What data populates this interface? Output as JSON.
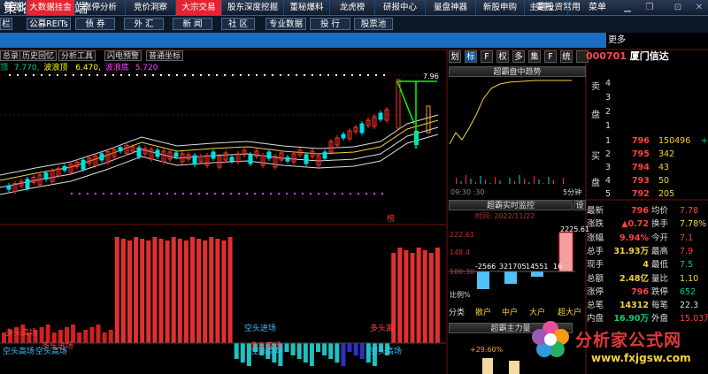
{
  "app": {
    "title": "策略投资终端"
  },
  "top_menu": [
    {
      "label": "栏"
    },
    {
      "label": "公募REITs"
    },
    {
      "label": "债 券"
    },
    {
      "label": "外 汇"
    },
    {
      "label": "新 闻"
    },
    {
      "label": "社 区"
    },
    {
      "label": "专业数据"
    },
    {
      "label": "投 行"
    },
    {
      "label": "股票池"
    }
  ],
  "right_menu": [
    {
      "label": "委托"
    },
    {
      "label": "常用"
    },
    {
      "label": "菜单"
    }
  ],
  "nav": {
    "items": [
      {
        "label": "捷金"
      },
      {
        "label": "大数据挂金"
      },
      {
        "label": "涨停分析"
      },
      {
        "label": "竞价洞察"
      },
      {
        "label": "大宗交易"
      },
      {
        "label": "股东深度挖掘"
      },
      {
        "label": "董秘爆料"
      },
      {
        "label": "龙虎榜"
      },
      {
        "label": "研报中心"
      },
      {
        "label": "量盘神器"
      },
      {
        "label": "新股申购"
      },
      {
        "label": "主题投资"
      }
    ],
    "more": "更多"
  },
  "chart_tools": [
    {
      "label": "总录"
    },
    {
      "label": "历史回忆"
    },
    {
      "label": "分析工具"
    },
    {
      "label": "闪电预警"
    },
    {
      "label": "普通坐标"
    }
  ],
  "indicator": {
    "prefix": "顶",
    "v1_label": "7.770,",
    "v2_name": "波浪顶",
    "v2_value": "6.470,",
    "v3_name": "波浪底",
    "v3_value": "5.720"
  },
  "chart_annotations": {
    "price_top": "7.96",
    "marker": "榜",
    "bottom_labels": [
      {
        "text": "多头高场"
      },
      {
        "text": "多头进场"
      },
      {
        "text": "空头高场"
      },
      {
        "text": "空头高场"
      },
      {
        "text": "多头离场"
      },
      {
        "text": "空头进场"
      },
      {
        "text": "多头离"
      },
      {
        "text": "空头高场"
      },
      {
        "text": "空头高场"
      }
    ]
  },
  "mid_tabs": [
    {
      "label": "划"
    },
    {
      "label": "标"
    },
    {
      "label": "F"
    },
    {
      "label": "权"
    },
    {
      "label": "多"
    },
    {
      "label": "集"
    },
    {
      "label": "F"
    },
    {
      "label": "统"
    }
  ],
  "mid_panel": {
    "intraday_title": "超霸盘中趋势",
    "intraday_footer_left": "09:30 :30",
    "intraday_footer_right": "5分钟",
    "monitor_title": "超霸实时监控",
    "monitor_time": "时间: 2022/11/22",
    "monitor_y1": "222.61",
    "monitor_y2": "148.4",
    "monitor_y3": "100.30",
    "monitor_pct": "比例%",
    "monitor_bars": [
      "-2566",
      "321705",
      "14551",
      "16"
    ],
    "monitor_top": "2225.61",
    "monitor_cats": [
      "分类",
      "散户",
      "中户",
      "大户",
      "超大户"
    ],
    "mainforce_title": "超霸主力量",
    "mainforce_value": "+29.60%"
  },
  "stock": {
    "code": "000701",
    "name": "厦门信达"
  },
  "orderbook": {
    "sell_label": "卖",
    "sell_label2": "盘",
    "buy_label": "买",
    "buy_label2": "盘",
    "buys": [
      {
        "level": "1",
        "price": "796",
        "vol": "150496",
        "flag": "+"
      },
      {
        "level": "2",
        "price": "795",
        "vol": "342"
      },
      {
        "level": "3",
        "price": "794",
        "vol": "43"
      },
      {
        "level": "4",
        "price": "793",
        "vol": "50"
      },
      {
        "level": "5",
        "price": "792",
        "vol": "205"
      }
    ],
    "sell_levels": [
      "4",
      "3",
      "2",
      "1"
    ]
  },
  "stats": [
    {
      "k1": "最新",
      "v1": "796",
      "k2": "均价",
      "v2": "7.78"
    },
    {
      "k1": "涨跌",
      "v1": "▲0.72",
      "k2": "换手",
      "v2": "7.78%"
    },
    {
      "k1": "涨幅",
      "v1": "9.94%",
      "k2": "今开",
      "v2": "7.1"
    },
    {
      "k1": "总手",
      "v1": "31.93万",
      "k2": "最高",
      "v2": "7.9"
    },
    {
      "k1": "现手",
      "v1": "4",
      "k2": "最低",
      "v2": "7.5"
    },
    {
      "k1": "总额",
      "v1": "2.48亿",
      "k2": "量比",
      "v2": "1.10"
    },
    {
      "k1": "涨停",
      "v1": "796",
      "k2": "跌停",
      "v2": "652"
    },
    {
      "k1": "总笔",
      "v1": "14312",
      "k2": "每笔",
      "v2": "22.3"
    },
    {
      "k1": "内盘",
      "v1": "16.90万",
      "k2": "外盘",
      "v2": "15.03万"
    }
  ],
  "watermark": {
    "text": "分析家公式网",
    "url": "www.fxjgsw.com"
  }
}
